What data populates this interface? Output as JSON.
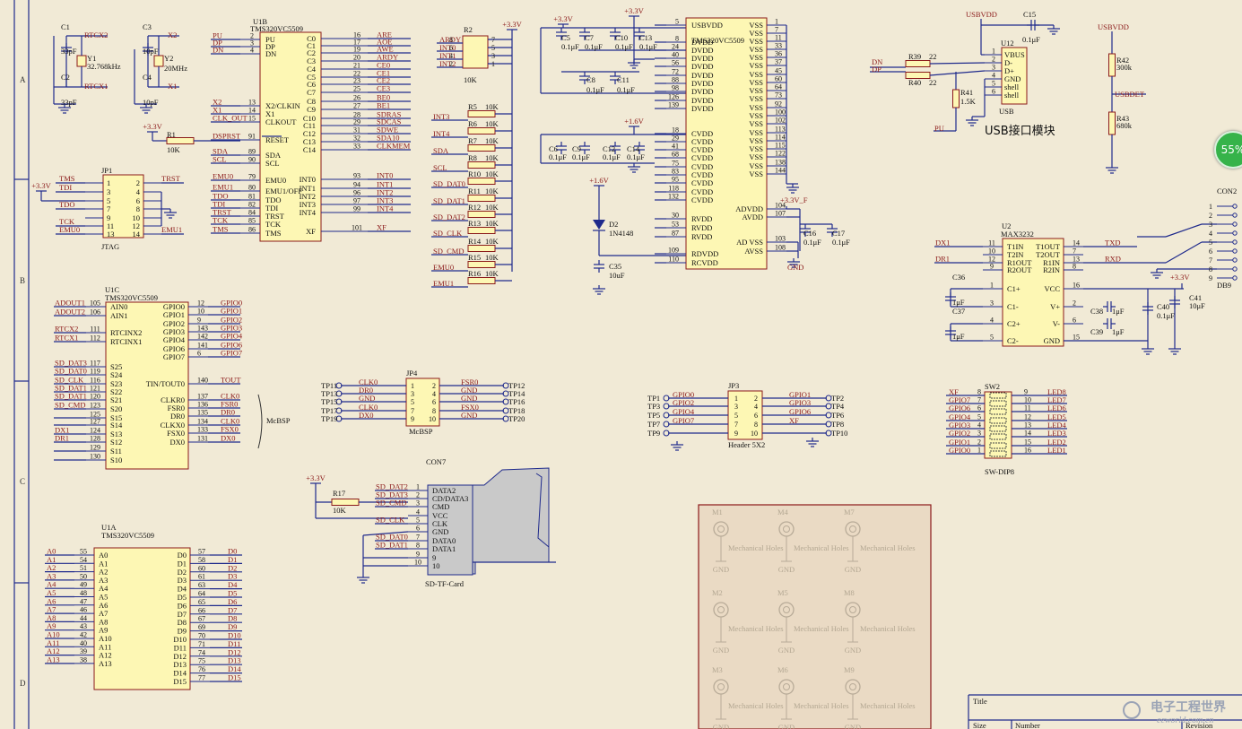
{
  "sheet": {
    "row_letters": [
      "A",
      "B",
      "C",
      "D"
    ],
    "usb_title": "USB接口模块",
    "badge": "55%",
    "title_block": {
      "title": "Title",
      "size": "Size",
      "number": "Number",
      "revision": "Revision"
    },
    "watermark_cn": "电子工程世界",
    "watermark_en": "eeworld.com.cn"
  },
  "u1b": {
    "des": "U1B",
    "part": "TMS320VC5509",
    "left": [
      {
        "net": "PU",
        "num": "2",
        "pin": "PU"
      },
      {
        "net": "DP",
        "num": "3",
        "pin": "DP"
      },
      {
        "net": "DN",
        "num": "4",
        "pin": "DN"
      },
      {
        "net": "X2",
        "num": "13",
        "pin": "X2/CLKIN"
      },
      {
        "net": "X1",
        "num": "14",
        "pin": "X1"
      },
      {
        "net": "CLK_OUT",
        "num": "15",
        "pin": "CLKOUT"
      },
      {
        "net": "DSPRST",
        "num": "91",
        "pin": "RESET"
      },
      {
        "net": "SDA",
        "num": "89",
        "pin": "SDA"
      },
      {
        "net": "SCL",
        "num": "90",
        "pin": "SCL"
      },
      {
        "net": "EMU0",
        "num": "79",
        "pin": "EMU0"
      },
      {
        "net": "EMU1",
        "num": "80",
        "pin": "EMU1/OFF"
      },
      {
        "net": "TDO",
        "num": "81",
        "pin": "TDO"
      },
      {
        "net": "TDI",
        "num": "82",
        "pin": "TDI"
      },
      {
        "net": "TRST",
        "num": "84",
        "pin": "TRST"
      },
      {
        "net": "TCK",
        "num": "85",
        "pin": "TCK"
      },
      {
        "net": "TMS",
        "num": "86",
        "pin": "TMS"
      }
    ],
    "right": [
      {
        "pin": "C0",
        "num": "16",
        "net": "ARE"
      },
      {
        "pin": "C1",
        "num": "17",
        "net": "AOE"
      },
      {
        "pin": "C2",
        "num": "19",
        "net": "AWE"
      },
      {
        "pin": "C3",
        "num": "20",
        "net": "ARDY"
      },
      {
        "pin": "C4",
        "num": "21",
        "net": "CE0"
      },
      {
        "pin": "C5",
        "num": "22",
        "net": "CE1"
      },
      {
        "pin": "C6",
        "num": "23",
        "net": "CE2"
      },
      {
        "pin": "C7",
        "num": "25",
        "net": "CE3"
      },
      {
        "pin": "C8",
        "num": "26",
        "net": "BE0"
      },
      {
        "pin": "C9",
        "num": "27",
        "net": "BE1"
      },
      {
        "pin": "C10",
        "num": "28",
        "net": "SDRAS"
      },
      {
        "pin": "C11",
        "num": "29",
        "net": "SDCAS"
      },
      {
        "pin": "C12",
        "num": "31",
        "net": "SDWE"
      },
      {
        "pin": "C13",
        "num": "32",
        "net": "SDA10"
      },
      {
        "pin": "C14",
        "num": "33",
        "net": "CLKMEM"
      },
      {
        "pin": "INT0",
        "num": "93",
        "net": "INT0"
      },
      {
        "pin": "INT1",
        "num": "94",
        "net": "INT1"
      },
      {
        "pin": "INT2",
        "num": "96",
        "net": "INT2"
      },
      {
        "pin": "INT3",
        "num": "97",
        "net": "INT3"
      },
      {
        "pin": "INT4",
        "num": "99",
        "net": "INT4"
      },
      {
        "pin": "XF",
        "num": "101",
        "net": "XF"
      }
    ]
  },
  "u1c": {
    "des": "U1C",
    "part": "TMS320VC5509",
    "left": [
      {
        "net": "ADOUT1",
        "num": "105",
        "pin": "AIN0"
      },
      {
        "net": "ADOUT2",
        "num": "106",
        "pin": "AIN1"
      },
      {
        "net": "RTCX2",
        "num": "111",
        "pin": "RTCINX2"
      },
      {
        "net": "RTCX1",
        "num": "112",
        "pin": "RTCINX1"
      },
      {
        "net": "SD_DAT3",
        "num": "117",
        "pin": "S25"
      },
      {
        "net": "SD_DAT0",
        "num": "119",
        "pin": "S24"
      },
      {
        "net": "SD_CLK",
        "num": "116",
        "pin": "S23"
      },
      {
        "net": "SD_DAT1",
        "num": "121",
        "pin": "S22"
      },
      {
        "net": "SD_DAT1",
        "num": "120",
        "pin": "S21"
      },
      {
        "net": "SD_CMD",
        "num": "123",
        "pin": "S20"
      },
      {
        "net": "",
        "num": "125",
        "pin": "S15"
      },
      {
        "net": "",
        "num": "127",
        "pin": "S14"
      },
      {
        "net": "DX1",
        "num": "124",
        "pin": "S13"
      },
      {
        "net": "DR1",
        "num": "128",
        "pin": "S12"
      },
      {
        "net": "",
        "num": "129",
        "pin": "S11"
      },
      {
        "net": "",
        "num": "130",
        "pin": "S10"
      }
    ],
    "right": [
      {
        "pin": "GPIO0",
        "num": "12",
        "net": "GPIO0"
      },
      {
        "pin": "GPIO1",
        "num": "10",
        "net": "GPIO1"
      },
      {
        "pin": "GPIO2",
        "num": "9",
        "net": "GPIO2"
      },
      {
        "pin": "GPIO3",
        "num": "143",
        "net": "GPIO3"
      },
      {
        "pin": "GPIO4",
        "num": "142",
        "net": "GPIO4"
      },
      {
        "pin": "GPIO6",
        "num": "141",
        "net": "GPIO6"
      },
      {
        "pin": "GPIO7",
        "num": "6",
        "net": "GPIO7"
      },
      {
        "pin": "TIN/TOUT0",
        "num": "140",
        "net": "TOUT"
      },
      {
        "pin": "CLKR0",
        "num": "137",
        "net": "CLK0"
      },
      {
        "pin": "FSR0",
        "num": "136",
        "net": "FSR0"
      },
      {
        "pin": "DR0",
        "num": "135",
        "net": "DR0"
      },
      {
        "pin": "CLKX0",
        "num": "134",
        "net": "CLK0"
      },
      {
        "pin": "FSX0",
        "num": "133",
        "net": "FSX0"
      },
      {
        "pin": "DX0",
        "num": "131",
        "net": "DX0"
      }
    ],
    "mcbsp": "McBSP"
  },
  "u1a": {
    "des": "U1A",
    "part": "TMS320VC5509",
    "addr": [
      [
        "A0",
        "55"
      ],
      [
        "A1",
        "54"
      ],
      [
        "A2",
        "51"
      ],
      [
        "A3",
        "50"
      ],
      [
        "A4",
        "49"
      ],
      [
        "A5",
        "48"
      ],
      [
        "A6",
        "47"
      ],
      [
        "A7",
        "46"
      ],
      [
        "A8",
        "44"
      ],
      [
        "A9",
        "43"
      ],
      [
        "A10",
        "42"
      ],
      [
        "A11",
        "40"
      ],
      [
        "A12",
        "39"
      ],
      [
        "A13",
        "38"
      ]
    ],
    "data": [
      [
        "D0",
        "57"
      ],
      [
        "D1",
        "58"
      ],
      [
        "D2",
        "60"
      ],
      [
        "D3",
        "61"
      ],
      [
        "D4",
        "63"
      ],
      [
        "D5",
        "64"
      ],
      [
        "D6",
        "65"
      ],
      [
        "D7",
        "66"
      ],
      [
        "D8",
        "67"
      ],
      [
        "D9",
        "69"
      ],
      [
        "D10",
        "70"
      ],
      [
        "D11",
        "71"
      ],
      [
        "D12",
        "74"
      ],
      [
        "D13",
        "75"
      ],
      [
        "D14",
        "76"
      ],
      [
        "D15",
        "77"
      ]
    ]
  },
  "crystals": {
    "c1": "C1",
    "c1v": "33pF",
    "c2": "C2",
    "c2v": "33pF",
    "y1": "Y1",
    "y1v": "32.768kHz",
    "rtcx2": "RTCX2",
    "rtcx1": "RTCX1",
    "c3": "C3",
    "c3v": "10pF",
    "c4": "C4",
    "c4v": "10pF",
    "y2": "Y2",
    "y2v": "20MHz",
    "x2": "X2",
    "x1": "X1"
  },
  "reset": {
    "v": "+3.3V",
    "r": "R1",
    "rv": "10K"
  },
  "jtag": {
    "des": "JP1",
    "part": "JTAG",
    "v": "+3.3V",
    "lnets": [
      "TMS",
      "TDI",
      "",
      "TDO",
      "",
      "TCK",
      "EMU0"
    ],
    "lnums": [
      "1",
      "3",
      "5",
      "7",
      "9",
      "11",
      "13"
    ],
    "rnums": [
      "2",
      "4",
      "6",
      "8",
      "10",
      "12",
      "14"
    ],
    "rnets": [
      "TRST",
      "",
      "",
      "",
      "",
      "",
      "EMU1"
    ]
  },
  "pullups": {
    "v": "+3.3V",
    "r2": "R2",
    "r2v": "10K",
    "r2nets": [
      "ARDY",
      "INT0",
      "INT1",
      "INT2"
    ],
    "r2nums": [
      "8",
      "6",
      "4",
      "2"
    ],
    "r2rnums": [
      "7",
      "5",
      "3",
      "1"
    ],
    "rows": [
      [
        "INT3",
        "R5",
        "10K"
      ],
      [
        "INT4",
        "R6",
        "10K"
      ],
      [
        "SDA",
        "R7",
        "10K"
      ],
      [
        "SCL",
        "R8",
        "10K"
      ],
      [
        "SD_DAT0",
        "R10",
        "10K"
      ],
      [
        "SD_DAT1",
        "R11",
        "10K"
      ],
      [
        "SD_DAT2",
        "R12",
        "10K"
      ],
      [
        "SD_CLK",
        "R13",
        "10K"
      ],
      [
        "SD_CMD",
        "R14",
        "10K"
      ],
      [
        "EMU0",
        "R15",
        "10K"
      ],
      [
        "EMU1",
        "R16",
        "10K"
      ]
    ]
  },
  "power": {
    "v33": "+3.3V",
    "v33b": "+3.3V",
    "v16": "+1.6V",
    "v16b": "+1.6V",
    "v33f": "+3.3V_F",
    "caps_top": [
      [
        "C5",
        "0.1μF"
      ],
      [
        "C7",
        "0.1μF"
      ],
      [
        "C10",
        "0.1μF"
      ],
      [
        "C13",
        "0.1μF"
      ],
      [
        "C8",
        "0.1μF"
      ],
      [
        "C11",
        "0.1μF"
      ]
    ],
    "caps_mid": [
      [
        "C6",
        "0.1μF"
      ],
      [
        "C9",
        "0.1μF"
      ],
      [
        "C12",
        "0.1μF"
      ],
      [
        "C14",
        "0.1μF"
      ]
    ],
    "caps_avdd": [
      [
        "C16",
        "0.1μF"
      ],
      [
        "C17",
        "0.1μF"
      ]
    ],
    "d2": "D2",
    "d2v": "1N4148",
    "c35": "C35",
    "c35v": "10uF",
    "gnd": "GND"
  },
  "u1d": {
    "part": "TMS320VC5509",
    "left": [
      [
        "5",
        "USBVDD"
      ],
      [
        "8",
        "DVDD"
      ],
      [
        "24",
        "DVDD"
      ],
      [
        "40",
        "DVDD"
      ],
      [
        "56",
        "DVDD"
      ],
      [
        "72",
        "DVDD"
      ],
      [
        "88",
        "DVDD"
      ],
      [
        "98",
        "DVDD"
      ],
      [
        "126",
        "DVDD"
      ],
      [
        "139",
        "DVDD"
      ],
      [
        "18",
        "CVDD"
      ],
      [
        "29",
        "CVDD"
      ],
      [
        "41",
        "CVDD"
      ],
      [
        "68",
        "CVDD"
      ],
      [
        "75",
        "CVDD"
      ],
      [
        "83",
        "CVDD"
      ],
      [
        "95",
        "CVDD"
      ],
      [
        "118",
        "CVDD"
      ],
      [
        "132",
        "CVDD"
      ],
      [
        "30",
        "RVDD"
      ],
      [
        "53",
        "RVDD"
      ],
      [
        "87",
        "RVDD"
      ],
      [
        "109",
        "RDVDD"
      ],
      [
        "110",
        "RCVDD"
      ]
    ],
    "right": [
      [
        "1",
        "VSS"
      ],
      [
        "7",
        "VSS"
      ],
      [
        "11",
        "VSS"
      ],
      [
        "33",
        "VSS"
      ],
      [
        "36",
        "VSS"
      ],
      [
        "37",
        "VSS"
      ],
      [
        "45",
        "VSS"
      ],
      [
        "60",
        "VSS"
      ],
      [
        "64",
        "VSS"
      ],
      [
        "73",
        "VSS"
      ],
      [
        "92",
        "VSS"
      ],
      [
        "100",
        "VSS"
      ],
      [
        "102",
        "VSS"
      ],
      [
        "113",
        "VSS"
      ],
      [
        "114",
        "VSS"
      ],
      [
        "115",
        "VSS"
      ],
      [
        "122",
        "VSS"
      ],
      [
        "138",
        "VSS"
      ],
      [
        "144",
        "VSS"
      ],
      [
        "104",
        "ADVDD"
      ],
      [
        "107",
        "AVDD"
      ],
      [
        "103",
        "AD VSS"
      ],
      [
        "108",
        "AVSS"
      ]
    ]
  },
  "usb": {
    "usbvdd": "USBVDD",
    "c15": "C15",
    "c15v": "0.1μF",
    "u12": "U12",
    "part": "USB",
    "pins": [
      [
        "1",
        "VBUS"
      ],
      [
        "2",
        "D-"
      ],
      [
        "3",
        "D+"
      ],
      [
        "4",
        "GND"
      ],
      [
        "5",
        "shell"
      ],
      [
        "6",
        "shell"
      ]
    ],
    "dn": "DN",
    "dp": "DP",
    "r39": "R39",
    "r40": "R40",
    "rv": "22",
    "r41": "R41",
    "r41v": "1.5K",
    "pu": "PU",
    "usbvdd2": "USBVDD",
    "r42": "R42",
    "r42v": "300k",
    "usbdet": "USBDET",
    "r43": "R43",
    "r43v": "680k"
  },
  "max3232": {
    "des": "U2",
    "part": "MAX3232",
    "left": [
      [
        "11",
        "T1IN",
        "DX1"
      ],
      [
        "10",
        "T2IN",
        ""
      ],
      [
        "12",
        "R1OUT",
        "DR1"
      ],
      [
        "9",
        "R2OUT",
        ""
      ],
      [
        "1",
        "C1+",
        ""
      ],
      [
        "3",
        "C1-",
        ""
      ],
      [
        "4",
        "C2+",
        ""
      ],
      [
        "5",
        "C2-",
        ""
      ]
    ],
    "right": [
      [
        "14",
        "T1OUT",
        "TXD"
      ],
      [
        "7",
        "T2OUT",
        ""
      ],
      [
        "13",
        "R1IN",
        "RXD"
      ],
      [
        "8",
        "R2IN",
        ""
      ],
      [
        "16",
        "VCC",
        ""
      ],
      [
        "2",
        "V+",
        ""
      ],
      [
        "6",
        "V-",
        ""
      ],
      [
        "15",
        "GND",
        ""
      ]
    ],
    "caps": [
      [
        "C36",
        "1μF"
      ],
      [
        "C37",
        "1μF"
      ],
      [
        "C38",
        "1μF"
      ],
      [
        "C39",
        "1μF"
      ],
      [
        "C40",
        "0.1μF"
      ],
      [
        "C41",
        "10μF"
      ]
    ],
    "v": "+3.3V",
    "con": "CON2",
    "conp": "DB9",
    "connums": [
      "1",
      "2",
      "3",
      "4",
      "5",
      "6",
      "7",
      "8",
      "9"
    ]
  },
  "jp4": {
    "des": "JP4",
    "part": "McBSP",
    "ltp": [
      "TP11",
      "TP13",
      "TP15",
      "TP17",
      "TP19"
    ],
    "lnet": [
      "CLK0",
      "DR0",
      "GND",
      "CLK0",
      "DX0"
    ],
    "lnum": [
      "1",
      "3",
      "5",
      "7",
      "9"
    ],
    "rnum": [
      "2",
      "4",
      "6",
      "8",
      "10"
    ],
    "rnet": [
      "FSR0",
      "GND",
      "GND",
      "FSX0",
      "GND"
    ],
    "rtp": [
      "TP12",
      "TP14",
      "TP16",
      "TP18",
      "TP20"
    ]
  },
  "jp3": {
    "des": "JP3",
    "part": "Header 5X2",
    "ltp": [
      "TP1",
      "TP3",
      "TP5",
      "TP7",
      "TP9"
    ],
    "lnet": [
      "GPIO0",
      "GPIO2",
      "GPIO4",
      "GPIO7",
      ""
    ],
    "lnum": [
      "1",
      "3",
      "5",
      "7",
      "9"
    ],
    "rnum": [
      "2",
      "4",
      "6",
      "8",
      "10"
    ],
    "rnet": [
      "GPIO1",
      "GPIO3",
      "GPIO6",
      "XF",
      ""
    ],
    "rtp": [
      "TP2",
      "TP4",
      "TP6",
      "TP8",
      "TP10"
    ]
  },
  "sw2": {
    "des": "SW2",
    "part": "SW-DIP8",
    "lnet": [
      "XF",
      "GPIO7",
      "GPIO6",
      "GPIO4",
      "GPIO3",
      "GPIO2",
      "GPIO1",
      "GPIO0"
    ],
    "lnum": [
      "8",
      "7",
      "6",
      "5",
      "4",
      "3",
      "2",
      "1"
    ],
    "rnum": [
      "9",
      "10",
      "11",
      "12",
      "13",
      "14",
      "15",
      "16"
    ],
    "rnet": [
      "LED8",
      "LED7",
      "LED6",
      "LED5",
      "LED4",
      "LED3",
      "LED2",
      "LED1"
    ]
  },
  "sdcard": {
    "des": "CON7",
    "part": "SD-TF-Card",
    "v": "+3.3V",
    "r17": "R17",
    "r17v": "10K",
    "lnet": [
      "SD_DAT2",
      "SD_DAT3",
      "SD_CMD",
      "",
      "SD_CLK",
      "",
      "SD_DAT0",
      "SD_DAT1",
      "",
      ""
    ],
    "nums": [
      "1",
      "2",
      "3",
      "4",
      "5",
      "6",
      "7",
      "8",
      "9",
      "10"
    ],
    "pins": [
      "DATA2",
      "CD/DATA3",
      "CMD",
      "VCC",
      "CLK",
      "GND",
      "DATA0",
      "DATA1",
      "9",
      "10"
    ]
  },
  "holes": {
    "items": [
      [
        "M1",
        "Mechanical Holes"
      ],
      [
        "M4",
        "Mechanical Holes"
      ],
      [
        "M7",
        "Mechanical Holes"
      ],
      [
        "M2",
        "Mechanical Holes"
      ],
      [
        "M5",
        "Mechanical Holes"
      ],
      [
        "M8",
        "Mechanical Holes"
      ],
      [
        "M3",
        "Mechanical Holes"
      ],
      [
        "M6",
        "Mechanical Holes"
      ],
      [
        "M9",
        "Mechanical Holes"
      ]
    ],
    "gnd": "GND"
  }
}
